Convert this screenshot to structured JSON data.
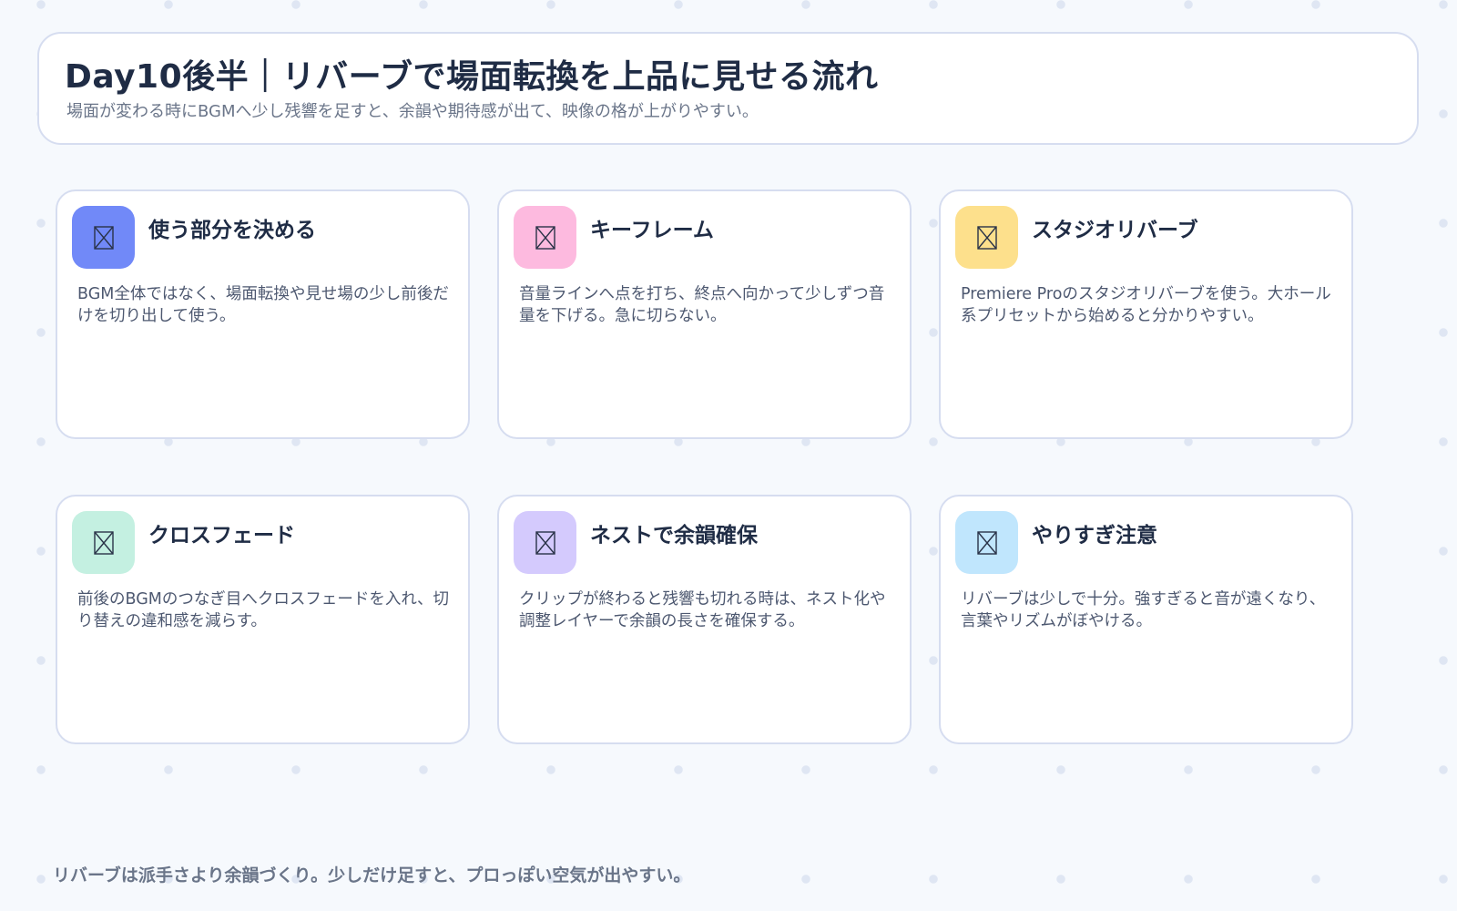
{
  "header": {
    "title": "Day10後半｜リバーブで場面転換を上品に見せる流れ",
    "subtitle": "場面が変わる時にBGMへ少し残響を足すと、余韻や期待感が出て、映像の格が上がりやすい。"
  },
  "cards": [
    {
      "title": "使う部分を決める",
      "description": "BGM全体ではなく、場面転換や見せ場の少し前後だけを切り出して使う。",
      "icon": "placeholder-icon",
      "color": "#7189f8"
    },
    {
      "title": "キーフレーム",
      "description": "音量ラインへ点を打ち、終点へ向かって少しずつ音量を下げる。急に切らない。",
      "icon": "placeholder-icon",
      "color": "#fdbadf"
    },
    {
      "title": "スタジオリバーブ",
      "description": "Premiere Proのスタジオリバーブを使う。大ホール系プリセットから始めると分かりやすい。",
      "icon": "placeholder-icon",
      "color": "#fde08c"
    },
    {
      "title": "クロスフェード",
      "description": "前後のBGMのつなぎ目へクロスフェードを入れ、切り替えの違和感を減らす。",
      "icon": "placeholder-icon",
      "color": "#c4f0e1"
    },
    {
      "title": "ネストで余韻確保",
      "description": "クリップが終わると残響も切れる時は、ネスト化や調整レイヤーで余韻の長さを確保する。",
      "icon": "placeholder-icon",
      "color": "#d4cafd"
    },
    {
      "title": "やりすぎ注意",
      "description": "リバーブは少しで十分。強すぎると音が遠くなり、言葉やリズムがぼやける。",
      "icon": "placeholder-icon",
      "color": "#c0e6fd"
    }
  ],
  "footer": {
    "text": "リバーブは派手さより余韻づくり。少しだけ足すと、プロっぽい空気が出やすい。"
  }
}
